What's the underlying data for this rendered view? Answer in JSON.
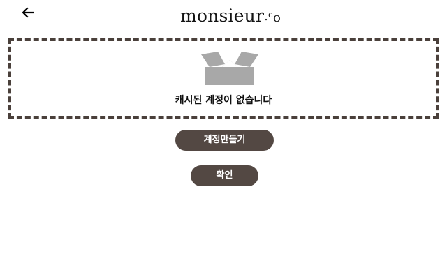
{
  "header": {
    "back_icon": "arrow-left-icon",
    "logo": {
      "main": "monsieur",
      "dot": ".",
      "c": "c",
      "o": "o"
    }
  },
  "empty_state": {
    "icon": "open-box-icon",
    "message": "캐시된 계정이 없습니다"
  },
  "actions": {
    "create_account_label": "계정만들기",
    "confirm_label": "확인"
  },
  "colors": {
    "button_bg": "#534843",
    "border": "#4a403b",
    "icon_gray": "#a8a8a8"
  }
}
